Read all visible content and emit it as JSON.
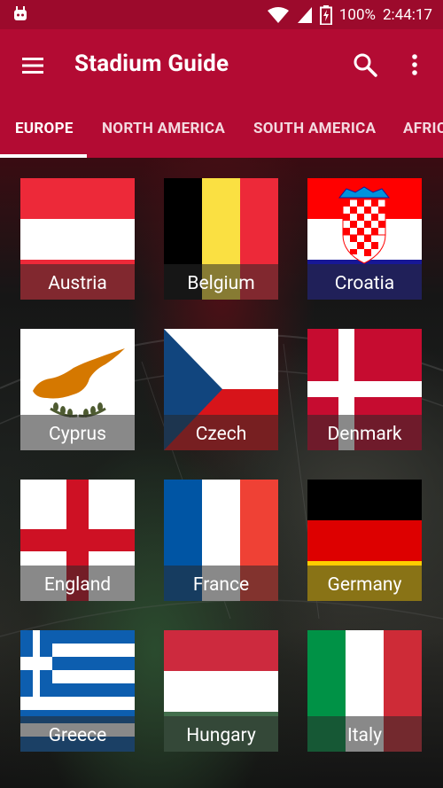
{
  "status_bar": {
    "battery": "100%",
    "time": "2:44:17"
  },
  "app_bar": {
    "title": "Stadium Guide"
  },
  "tabs": [
    {
      "label": "EUROPE"
    },
    {
      "label": "NORTH AMERICA"
    },
    {
      "label": "SOUTH AMERICA"
    },
    {
      "label": "AFRICA"
    }
  ],
  "countries": [
    {
      "name": "Austria"
    },
    {
      "name": "Belgium"
    },
    {
      "name": "Croatia"
    },
    {
      "name": "Cyprus"
    },
    {
      "name": "Czech"
    },
    {
      "name": "Denmark"
    },
    {
      "name": "England"
    },
    {
      "name": "France"
    },
    {
      "name": "Germany"
    },
    {
      "name": "Greece"
    },
    {
      "name": "Hungary"
    },
    {
      "name": "Italy"
    }
  ],
  "colors": {
    "status_bar": "#9c0a2c",
    "app_bar": "#b30b33"
  }
}
